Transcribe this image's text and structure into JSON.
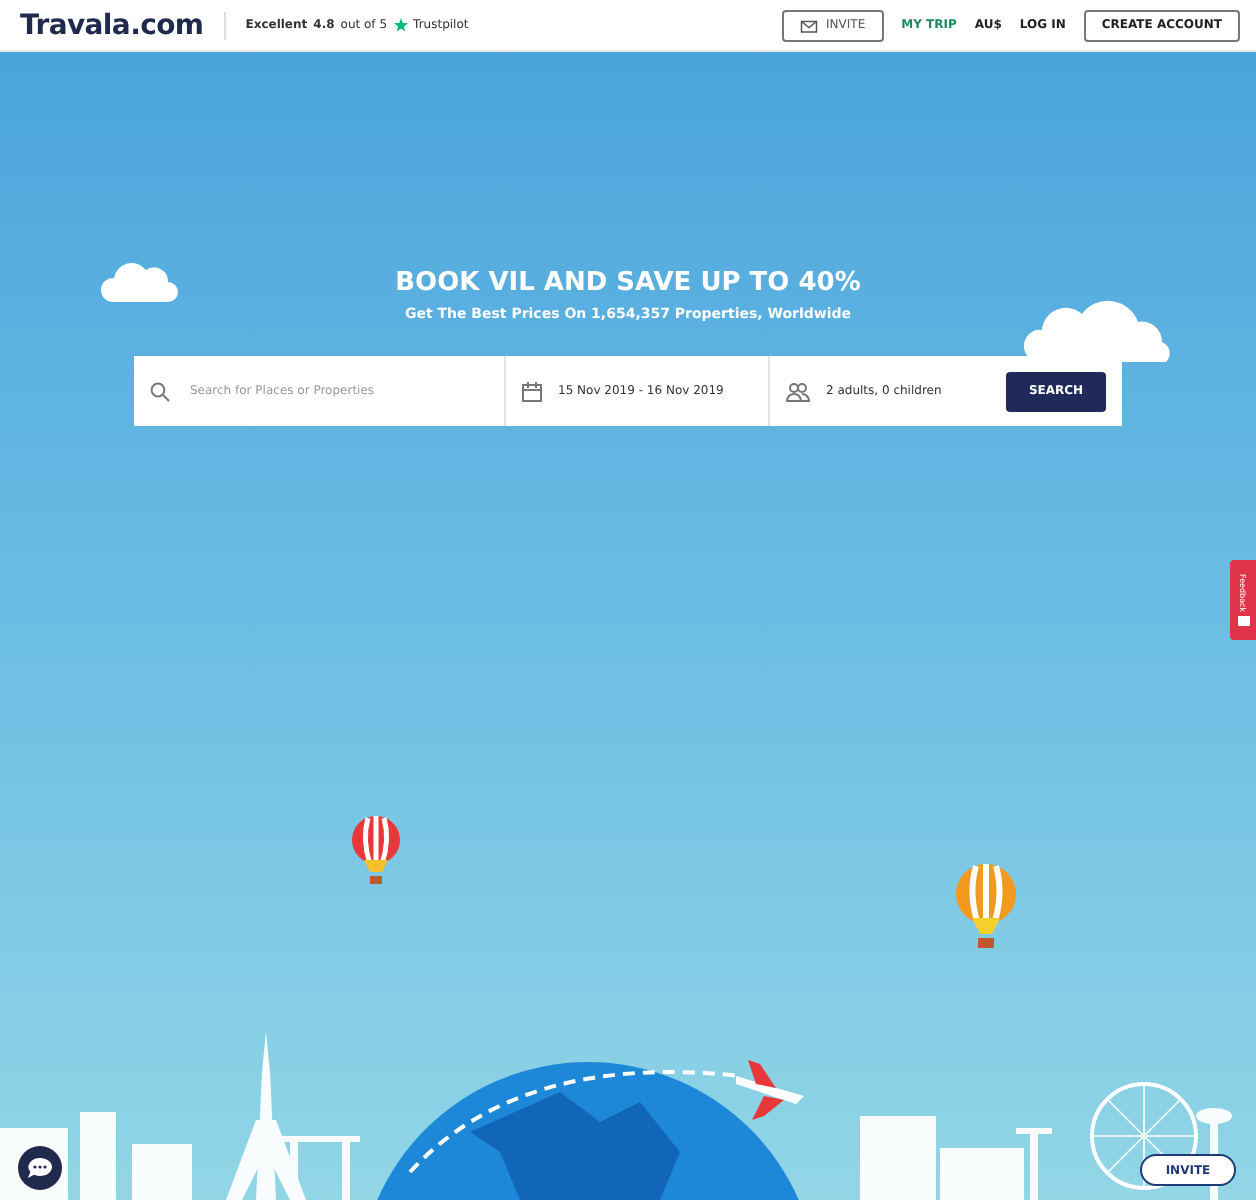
{
  "header": {
    "logo": "Travala.com",
    "rating": {
      "label": "Excellent",
      "score": "4.8",
      "scale": "out of 5",
      "brand": "Trustpilot"
    },
    "nav": [
      {
        "kind": "outlined-icon",
        "label": "INVITE"
      },
      {
        "kind": "accent",
        "label": "MY TRIP"
      },
      {
        "kind": "plain",
        "label": "AU$"
      },
      {
        "kind": "plain",
        "label": "LOG IN"
      },
      {
        "kind": "outlined",
        "label": "CREATE ACCOUNT"
      }
    ]
  },
  "hero": {
    "title": "BOOK VIL AND SAVE UP TO 40%",
    "subtitle": "Get The Best Prices On 1,654,357 Properties, Worldwide"
  },
  "search": {
    "placeholder": "Search for Places or Properties",
    "dates": "15 Nov 2019 - 16 Nov 2019",
    "guests": "2 adults, 0 children",
    "button": "SEARCH"
  },
  "feedback_tab": {
    "label": "Feedback"
  },
  "floating_invite": {
    "label": "INVITE"
  }
}
